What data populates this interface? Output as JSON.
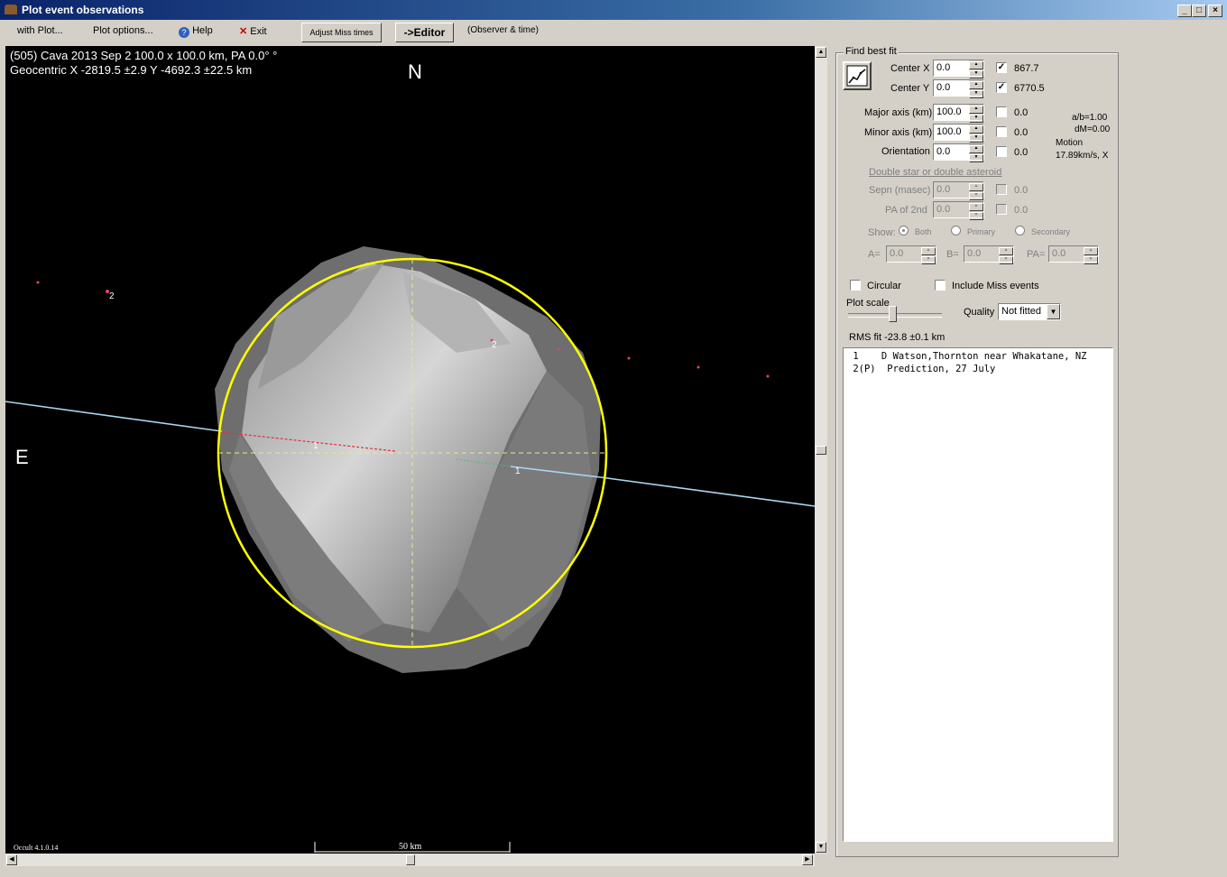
{
  "window": {
    "title": "Plot event observations"
  },
  "menu": {
    "with_plot": "with Plot...",
    "plot_options": "Plot options...",
    "help": "Help",
    "exit": "Exit",
    "adjust_miss": "Adjust Miss times",
    "editor": "->Editor",
    "observer_time": "(Observer & time)"
  },
  "plot": {
    "line1": "(505) Cava  2013 Sep 2  100.0 x 100.0 km, PA 0.0° °",
    "line2": "Geocentric X -2819.5 ±2.9  Y -4692.3 ±22.5 km",
    "north": "N",
    "east": "E",
    "scale_label": "50 km",
    "version": "Occult 4.1.0.14",
    "chord1_label": "1",
    "chord1b_label": "1",
    "chord2_label": "2",
    "point2_label": "2",
    "ellipse_color": "#ffff00",
    "path_color": "#a8d8f0"
  },
  "panel": {
    "find_best_fit": "Find best fit",
    "center_x_label": "Center X",
    "center_x_value": "0.0",
    "center_x_fit": "867.7",
    "center_y_label": "Center Y",
    "center_y_value": "0.0",
    "center_y_fit": "6770.5",
    "major_label": "Major axis (km)",
    "major_value": "100.0",
    "major_fit": "0.0",
    "minor_label": "Minor axis (km)",
    "minor_value": "100.0",
    "minor_fit": "0.0",
    "orient_label": "Orientation",
    "orient_value": "0.0",
    "orient_fit": "0.0",
    "ab": "a/b=1.00",
    "dm": "dM=0.00",
    "motion_label": "Motion",
    "motion_value": "17.89km/s, X",
    "double_link": "Double star  or  double asteroid",
    "sepn_label": "Sepn (masec)",
    "sepn_value": "0.0",
    "sepn_fit": "0.0",
    "pa2_label": "PA of 2nd",
    "pa2_value": "0.0",
    "pa2_fit": "0.0",
    "show_label": "Show:",
    "show_both": "Both",
    "show_primary": "Primary",
    "show_secondary": "Secondary",
    "a_label": "A=",
    "a_value": "0.0",
    "b_label": "B=",
    "b_value": "0.0",
    "pa_label": "PA=",
    "pa_value": "0.0",
    "circular": "Circular",
    "include_miss": "Include Miss events",
    "plot_scale": "Plot scale",
    "quality_label": "Quality",
    "quality_value": "Not fitted",
    "rms": "RMS fit -23.8 ±0.1 km"
  },
  "list": [
    " 1    D Watson,Thornton near Whakatane, NZ",
    " 2(P)  Prediction, 27 July"
  ]
}
